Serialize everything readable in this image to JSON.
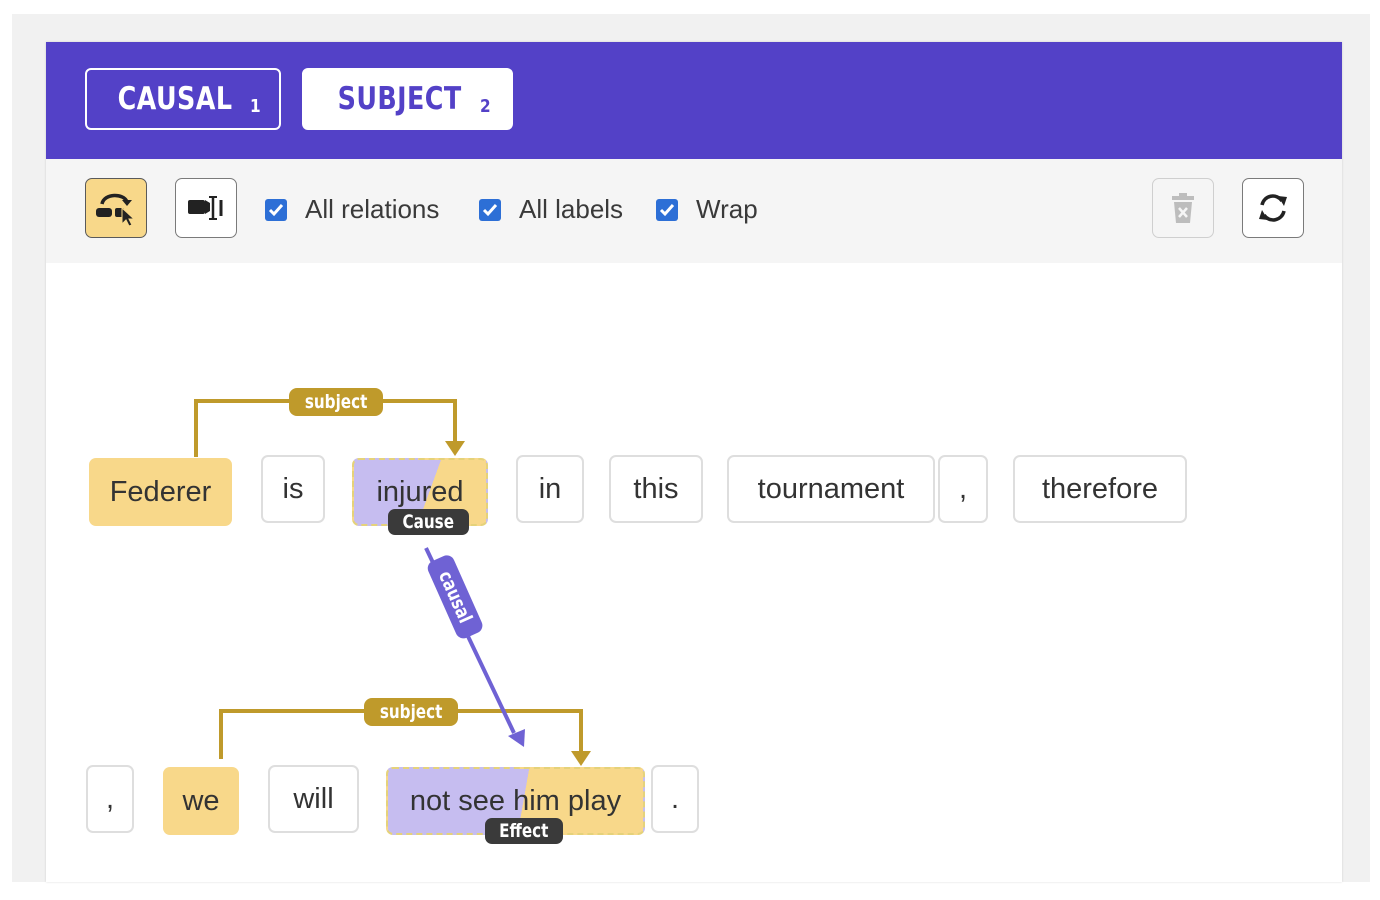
{
  "tabs": [
    {
      "label": "CAUSAL",
      "count": "1"
    },
    {
      "label": "SUBJECT",
      "count": "2"
    }
  ],
  "toolbar": {
    "checks": [
      {
        "label": "All relations",
        "checked": true
      },
      {
        "label": "All labels",
        "checked": true
      },
      {
        "label": "Wrap",
        "checked": true
      }
    ],
    "icons": {
      "mode": "relation-mode-icon",
      "cursor": "text-cursor-icon",
      "delete": "trash-icon",
      "refresh": "refresh-icon"
    }
  },
  "colors": {
    "header": "#5341c7",
    "label_gold": "#f8d88a",
    "relation_gold": "#bf9a2b",
    "relation_purple": "#6f62d4",
    "cause_purple": "#c6bdf0",
    "checkbox": "#2d6fd6"
  },
  "tokens_row1": [
    "Federer",
    "is",
    "injured",
    "in",
    "this",
    "tournament",
    ",",
    "therefore"
  ],
  "tokens_row2": [
    ",",
    "we",
    "will",
    "not see him play",
    "."
  ],
  "labels": {
    "cause": "Cause",
    "effect": "Effect"
  },
  "relations": {
    "subject1": "subject",
    "subject2": "subject",
    "causal": "causal"
  }
}
